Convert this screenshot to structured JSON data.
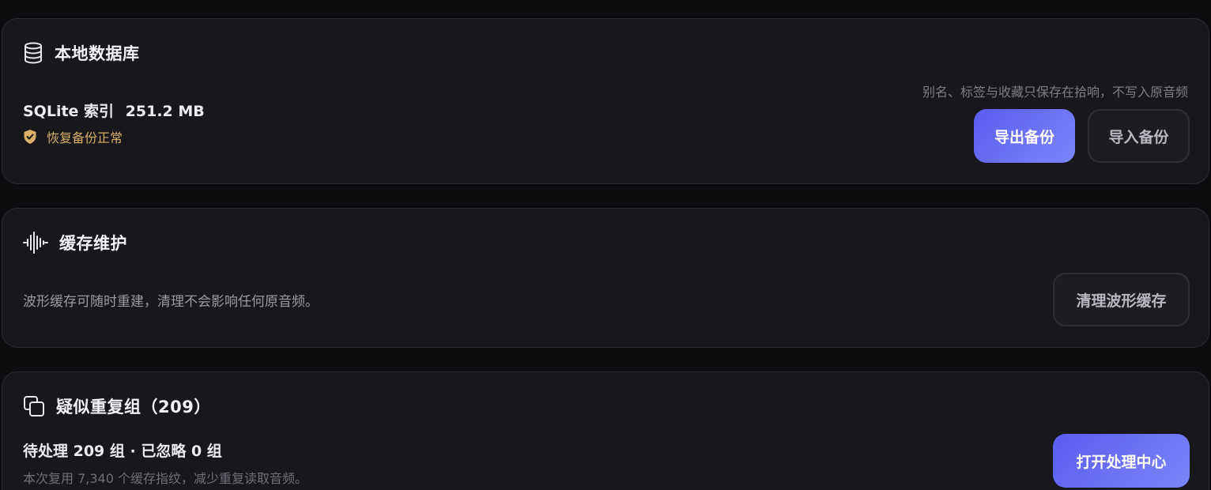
{
  "local_db": {
    "title": "本地数据库",
    "icon": "database-icon",
    "index_label": "SQLite 索引",
    "index_size": "251.2 MB",
    "status_text": "恢复备份正常",
    "status_icon": "shield-check-icon",
    "status_color": "#d8b068",
    "note": "别名、标签与收藏只保存在拾响，不写入原音频",
    "export_label": "导出备份",
    "import_label": "导入备份"
  },
  "cache": {
    "title": "缓存维护",
    "icon": "waveform-icon",
    "description": "波形缓存可随时重建，清理不会影响任何原音频。",
    "clear_label": "清理波形缓存"
  },
  "duplicates": {
    "title": "疑似重复组（209）",
    "icon": "copy-icon",
    "summary": "待处理 209 组 · 已忽略 0 组",
    "detail": "本次复用 7,340 个缓存指纹，减少重复读取音频。",
    "open_label": "打开处理中心"
  },
  "colors": {
    "accent_start": "#5b5cf0",
    "accent_end": "#7a86f8",
    "background": "#0d0d10",
    "card": "#18181c"
  }
}
